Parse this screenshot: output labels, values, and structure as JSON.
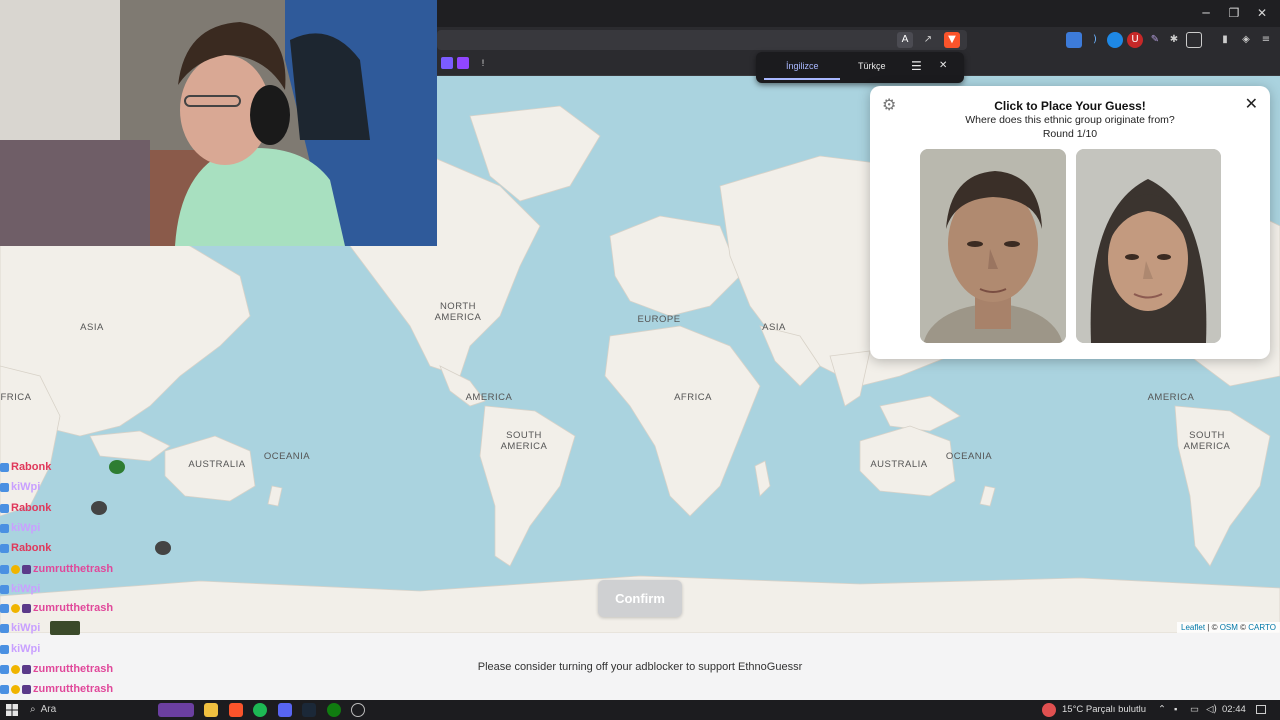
{
  "browser": {
    "window_controls": {
      "minimize": "─",
      "restore": "❐",
      "close": "✕"
    },
    "translate_popover": {
      "tab_source": "İngilizce",
      "tab_target": "Türkçe",
      "menu": "☰",
      "close": "✕"
    }
  },
  "panel": {
    "title": "Click to Place Your Guess!",
    "question": "Where does this ethnic group originate from?",
    "round": "Round 1/10",
    "close": "✕",
    "settings": "⚙"
  },
  "map": {
    "labels": {
      "asia_left": "ASIA",
      "africa_left": "FRICA",
      "australia_left": "AUSTRALIA",
      "oceania_left": "OCEANIA",
      "north_america": "NORTH\nAMERICA",
      "america_mid": "AMERICA",
      "south_america_mid": "SOUTH\nAMERICA",
      "europe": "EUROPE",
      "africa": "AFRICA",
      "asia_right": "ASIA",
      "australia_right": "AUSTRALIA",
      "oceania_right": "OCEANIA",
      "america_right": "AMERICA",
      "south_america_right": "SOUTH\nAMERICA"
    },
    "attribution": {
      "leaflet": "Leaflet",
      "sep1": " | © ",
      "osm": "OSM",
      "sep2": " © ",
      "carto": "CARTO"
    }
  },
  "confirm_label": "Confirm",
  "footer_message": "Please consider turning off your adblocker to support EthnoGuessr",
  "chat": [
    {
      "name": "Rabonk",
      "color": "#e0385b",
      "msg": "",
      "emote": "#2e7d32"
    },
    {
      "name": "kiWpi",
      "color": "#c9a0ff",
      "msg": "",
      "emote": ""
    },
    {
      "name": "Rabonk",
      "color": "#e0385b",
      "msg": "",
      "emote": "#444"
    },
    {
      "name": "kiWpi",
      "color": "#c9a0ff",
      "msg": "",
      "emote": ""
    },
    {
      "name": "Rabonk",
      "color": "#e0385b",
      "msg": "",
      "emote": "#444"
    },
    {
      "name": "zumrutthetrash",
      "color": "#e0489a",
      "msg": "",
      "emote": ""
    },
    {
      "name": "kiWpi",
      "color": "#c9a0ff",
      "msg": "",
      "emote": ""
    },
    {
      "name": "zumrutthetrash",
      "color": "#e0489a",
      "msg": "",
      "emote": ""
    },
    {
      "name": "kiWpi",
      "color": "#c9a0ff",
      "msg": "",
      "emote": "#3b4a2a"
    },
    {
      "name": "kiWpi",
      "color": "#c9a0ff",
      "msg": "",
      "emote": ""
    },
    {
      "name": "zumrutthetrash",
      "color": "#e0489a",
      "msg": "",
      "emote": ""
    },
    {
      "name": "zumrutthetrash",
      "color": "#e0489a",
      "msg": "",
      "emote": ""
    }
  ],
  "taskbar": {
    "search": "Ara",
    "weather": "15°C  Parçalı bulutlu",
    "clock": "02:44"
  },
  "colors": {
    "water": "#aad3df",
    "land": "#f2efe9",
    "brave": "#fb542b"
  }
}
